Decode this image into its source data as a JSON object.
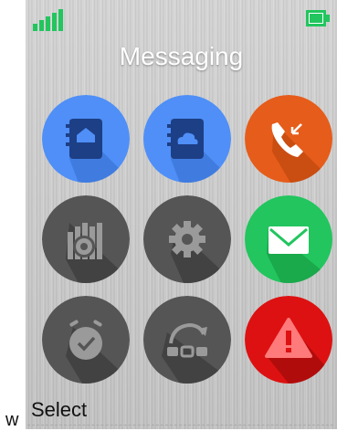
{
  "header": {
    "title": "Messaging",
    "signal_icon": "signal-strength-icon",
    "battery_icon": "battery-icon"
  },
  "colors": {
    "blue": "#4f8ff7",
    "orange": "#e65c1a",
    "gray": "#555555",
    "green": "#22c55e",
    "red": "#dd1111",
    "status_green": "#22c55e"
  },
  "menu": {
    "items": [
      {
        "icon": "local-contacts-icon"
      },
      {
        "icon": "cloud-contacts-icon"
      },
      {
        "icon": "call-list-icon"
      },
      {
        "icon": "settings-advanced-icon"
      },
      {
        "icon": "settings-gear-icon"
      },
      {
        "icon": "messaging-envelope-icon"
      },
      {
        "icon": "alarm-clock-icon"
      },
      {
        "icon": "connections-icon"
      },
      {
        "icon": "alarm-warning-icon"
      }
    ]
  },
  "softkeys": {
    "prefix": "w",
    "left_label": "Select"
  }
}
